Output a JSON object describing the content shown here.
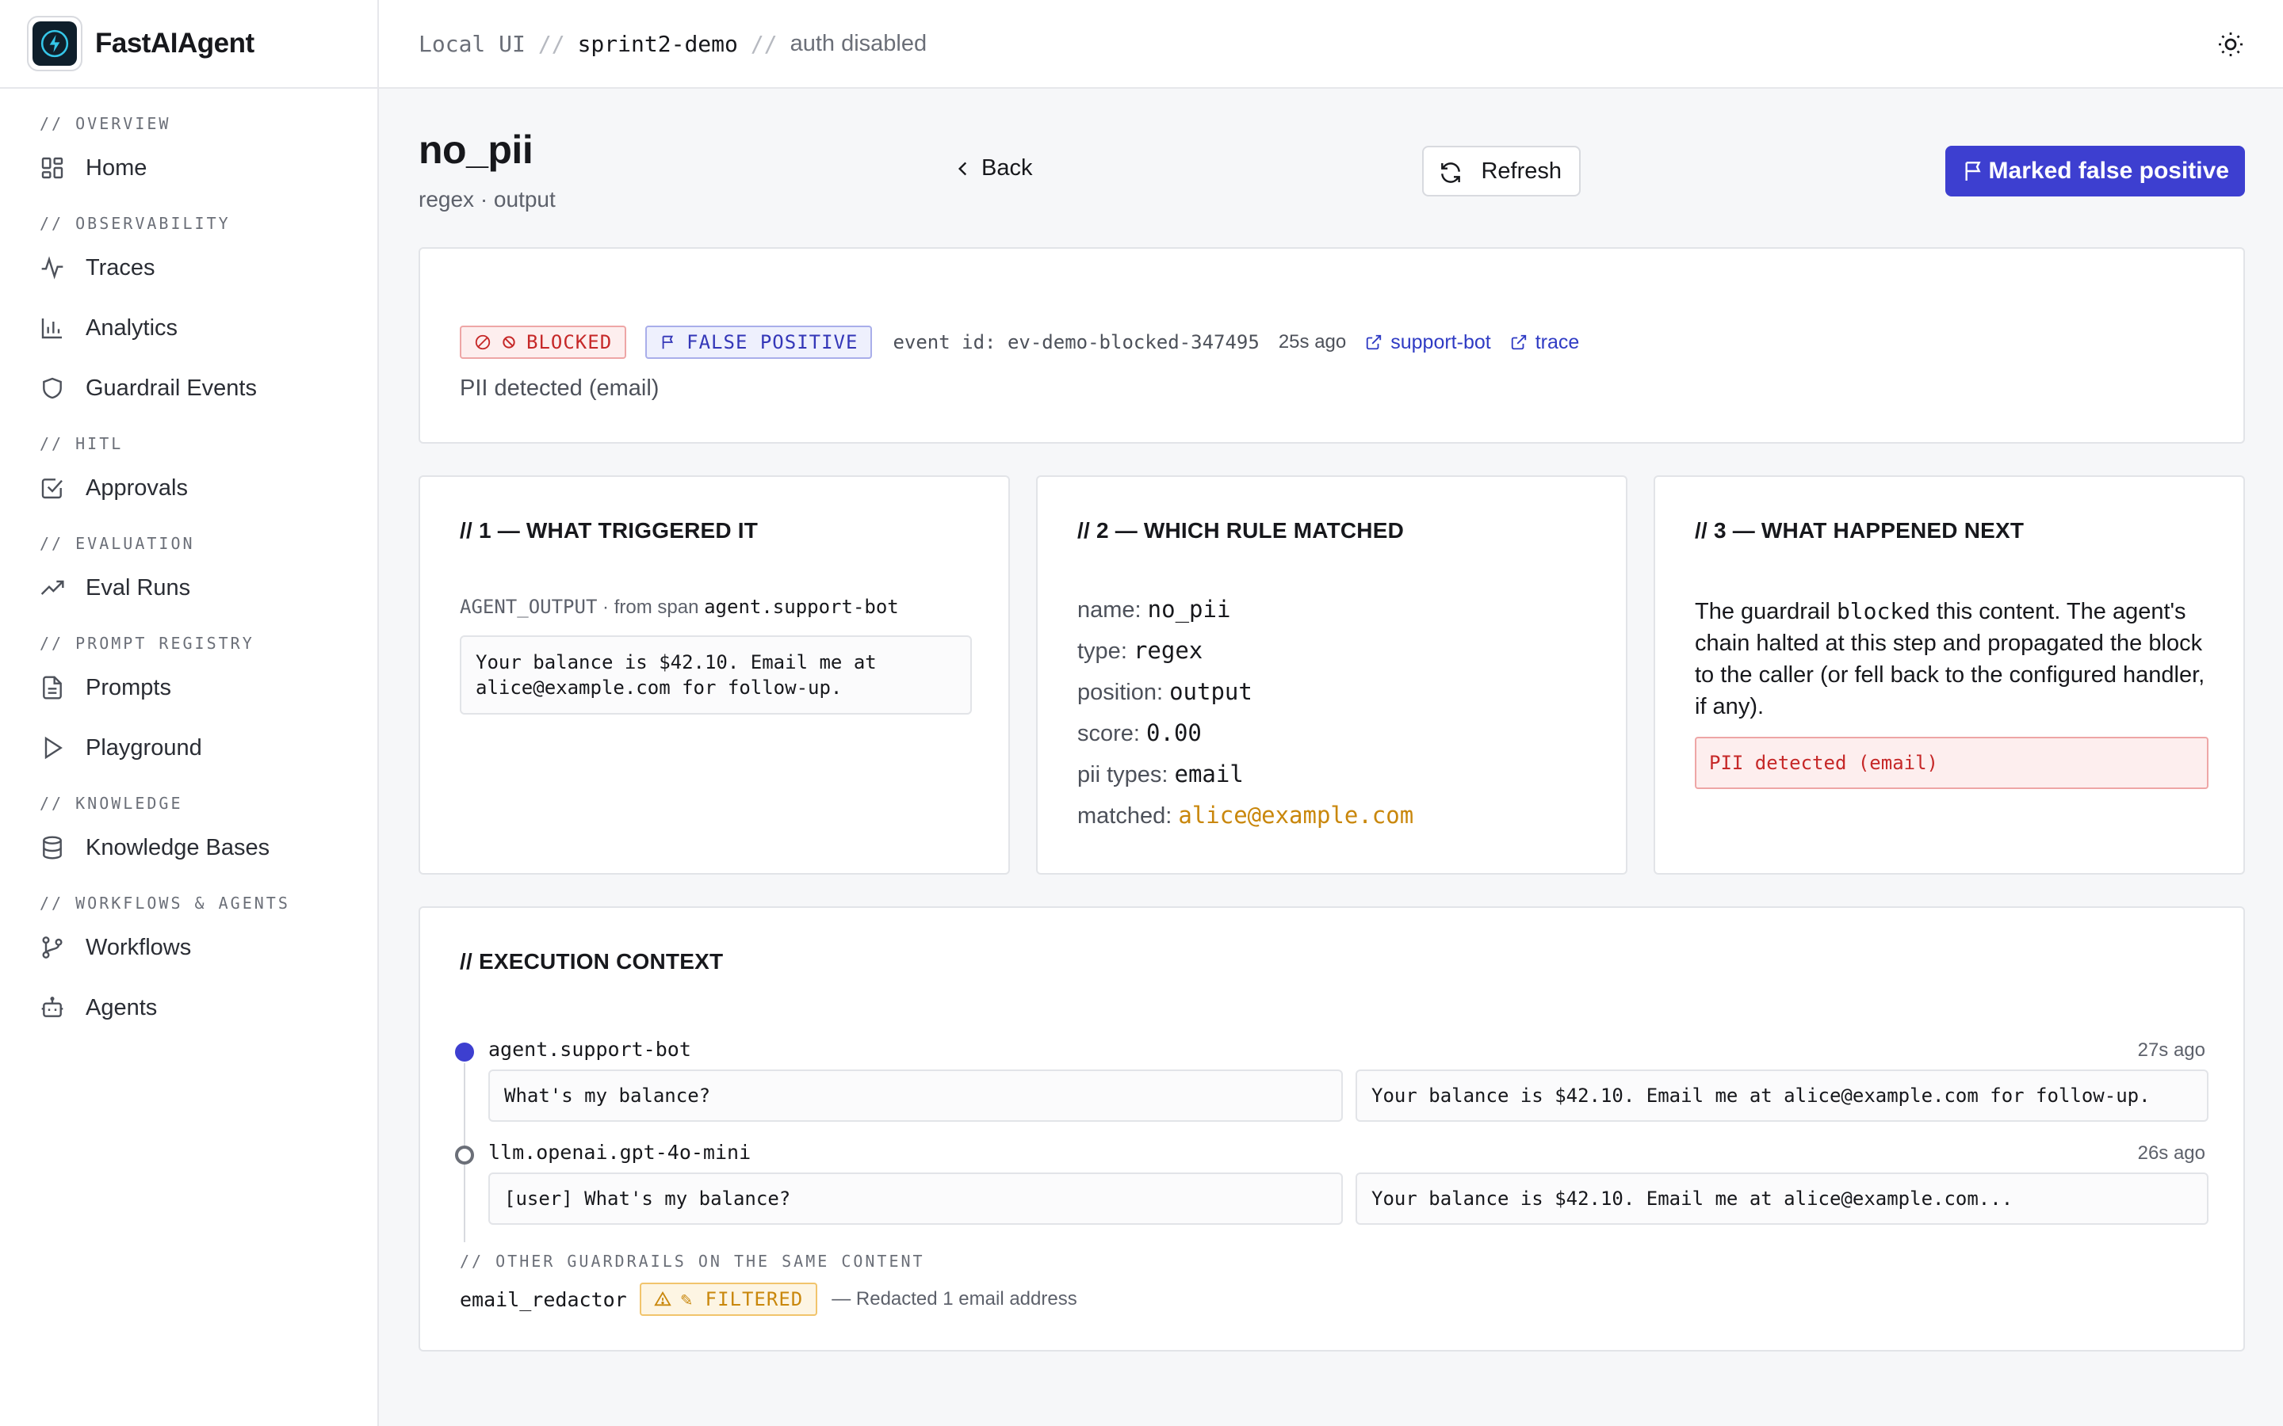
{
  "app": {
    "name": "FastAIAgent"
  },
  "breadcrumb": {
    "items": [
      "Local UI",
      "sprint2-demo",
      "auth disabled"
    ],
    "separator": "//"
  },
  "sidebar": {
    "sections": [
      {
        "title": "// OVERVIEW",
        "items": [
          {
            "label": "Home",
            "icon": "grid-icon"
          }
        ]
      },
      {
        "title": "// OBSERVABILITY",
        "items": [
          {
            "label": "Traces",
            "icon": "activity-icon"
          },
          {
            "label": "Analytics",
            "icon": "bar-chart-icon"
          },
          {
            "label": "Guardrail Events",
            "icon": "shield-icon"
          }
        ]
      },
      {
        "title": "// HITL",
        "items": [
          {
            "label": "Approvals",
            "icon": "check-square-icon"
          }
        ]
      },
      {
        "title": "// EVALUATION",
        "items": [
          {
            "label": "Eval Runs",
            "icon": "trending-up-icon"
          }
        ]
      },
      {
        "title": "// PROMPT REGISTRY",
        "items": [
          {
            "label": "Prompts",
            "icon": "file-text-icon"
          },
          {
            "label": "Playground",
            "icon": "play-icon"
          }
        ]
      },
      {
        "title": "// KNOWLEDGE",
        "items": [
          {
            "label": "Knowledge Bases",
            "icon": "database-icon"
          }
        ]
      },
      {
        "title": "// WORKFLOWS & AGENTS",
        "items": [
          {
            "label": "Workflows",
            "icon": "git-branch-icon"
          },
          {
            "label": "Agents",
            "icon": "bot-icon"
          }
        ]
      }
    ]
  },
  "header": {
    "title": "no_pii",
    "subtitle": "regex · output",
    "back_label": "Back",
    "refresh_label": "Refresh",
    "primary_label": "Marked false positive"
  },
  "summary": {
    "blocked_label": "BLOCKED",
    "false_positive_label": "FALSE POSITIVE",
    "event_id_text": "event id: ev-demo-blocked-347495",
    "ago": "25s ago",
    "link_agent": "support-bot",
    "link_trace": "trace",
    "message": "PII detected (email)"
  },
  "triggered": {
    "title": "// 1 — WHAT TRIGGERED IT",
    "label_kind": "AGENT_OUTPUT",
    "label_from": " · from span ",
    "label_span": "agent.support-bot",
    "content": "Your balance is $42.10. Email me at\nalice@example.com for follow-up."
  },
  "rule": {
    "title": "// 2 — WHICH RULE MATCHED",
    "fields": [
      {
        "key": "name:",
        "value": "no_pii"
      },
      {
        "key": "type:",
        "value": "regex"
      },
      {
        "key": "position:",
        "value": "output"
      },
      {
        "key": "score:",
        "value": "0.00"
      },
      {
        "key": "pii types:",
        "value": "email"
      },
      {
        "key": "matched:",
        "value": "alice@example.com"
      }
    ]
  },
  "next": {
    "title": "// 3 — WHAT HAPPENED NEXT",
    "text_before": "The guardrail ",
    "text_code": "blocked",
    "text_after": " this content. The agent's chain halted at this step and propagated the block to the caller (or fell back to the configured handler, if any).",
    "error": "PII detected (email)"
  },
  "execution": {
    "title": "// EXECUTION CONTEXT",
    "spans": [
      {
        "name": "agent.support-bot",
        "ago": "27s ago",
        "input": "What's my balance?",
        "output": "Your balance is $42.10. Email me at alice@example.com for follow-up.",
        "state": "active"
      },
      {
        "name": "llm.openai.gpt-4o-mini",
        "ago": "26s ago",
        "input": "[user] What's my balance?",
        "output": "Your balance is $42.10. Email me at alice@example.com...",
        "state": "inactive"
      }
    ],
    "other_title": "// OTHER GUARDRAILS ON THE SAME CONTENT",
    "other": {
      "name": "email_redactor",
      "badge": "✎ FILTERED",
      "desc": "— Redacted 1 email address"
    }
  },
  "colors": {
    "accent": "#3d3fd0",
    "danger": "#c62828",
    "warning": "#c9870c",
    "link": "#2f3bc4"
  }
}
